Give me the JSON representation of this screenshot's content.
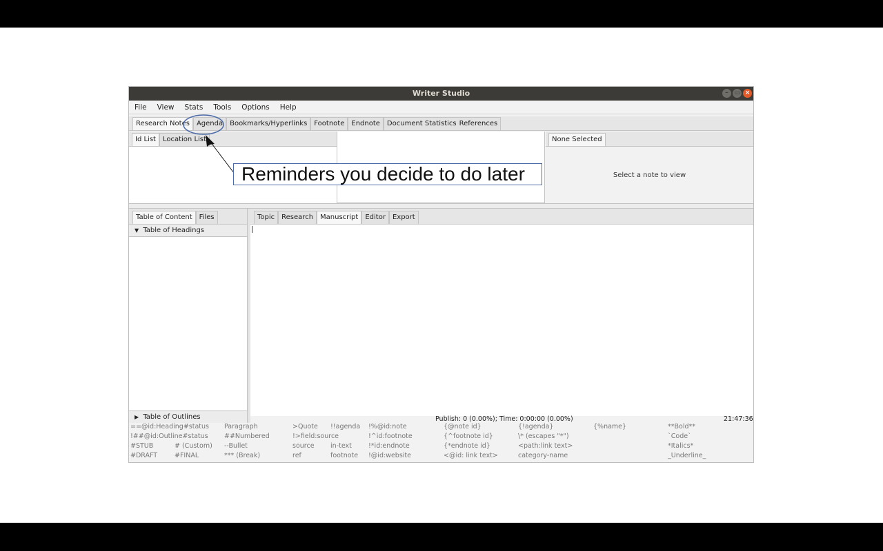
{
  "window": {
    "title": "Writer Studio"
  },
  "menu": [
    "File",
    "View",
    "Stats",
    "Tools",
    "Options",
    "Help"
  ],
  "top_tabs": [
    "Research Notes",
    "Agenda",
    "Bookmarks/Hyperlinks",
    "Footnote",
    "Endnote",
    "Document Statistics",
    "References"
  ],
  "id_tabs": [
    "Id List",
    "Location List"
  ],
  "note_panel": {
    "tab": "None Selected",
    "message": "Select a note to view"
  },
  "left_tabs": [
    "Table of Content",
    "Files"
  ],
  "tree": {
    "headings": "Table of Headings",
    "outlines": "Table of Outlines"
  },
  "editor_tabs": [
    "Topic",
    "Research",
    "Manuscript",
    "Editor",
    "Export"
  ],
  "active_editor_tab": "Manuscript",
  "status": {
    "publish": "Publish: 0 (0.00%); Time: 0:00:00 (0.00%)",
    "clock": "21:47:36"
  },
  "hints": [
    [
      "==@id:Heading#status",
      "Paragraph",
      ">Quote",
      "!!agenda",
      "!%@id:note",
      "{@note id}",
      "{!agenda}",
      "{%name}",
      "**Bold**"
    ],
    [
      "!##@id:Outline#status",
      "##Numbered",
      "!>field:source",
      "",
      "!^id:footnote",
      "{^footnote id}",
      "\\* (escapes \"*\")",
      "",
      "`Code`"
    ],
    [
      "#STUB",
      "# (Custom)",
      "--Bullet",
      "source",
      "in-text",
      "!*id:endnote",
      "{*endnote id}",
      "<path:link text>",
      "*Italics*"
    ],
    [
      "#DRAFT",
      "#FINAL",
      "*** (Break)",
      "ref",
      "footnote",
      "!@id:website",
      "<@id: link text>",
      "category-name",
      "_Underline_"
    ]
  ],
  "callout": {
    "text": "Reminders you decide to do later"
  },
  "colors": {
    "titlebar": "#3c3b37",
    "callout_border": "#4a6aa8"
  }
}
